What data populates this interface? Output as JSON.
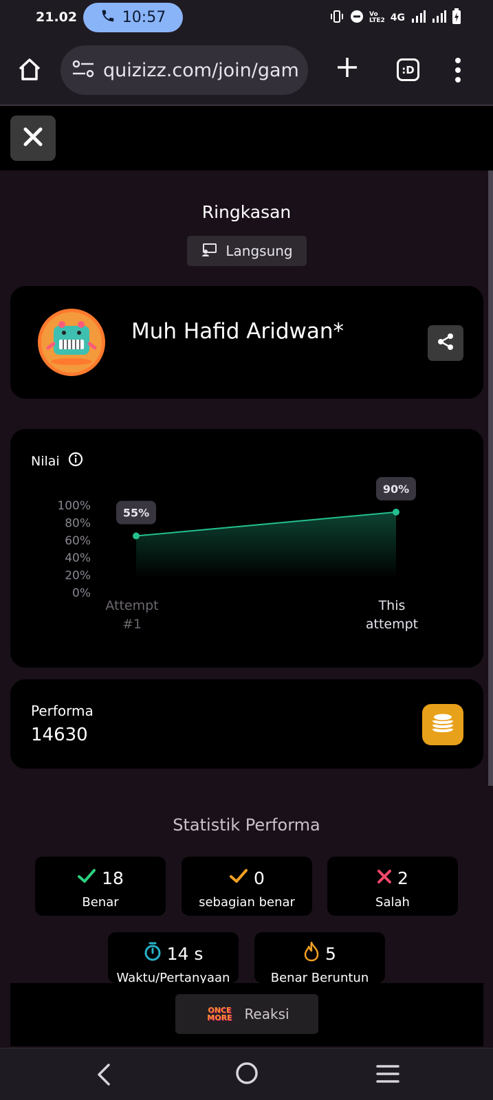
{
  "status_bar": {
    "time": "21.02",
    "call_time": "10:57",
    "network_label": "4G",
    "volte_label": "VoLTE2"
  },
  "browser": {
    "url": "quizizz.com/join/gam",
    "tabs_label": ":D"
  },
  "summary": {
    "title": "Ringkasan",
    "mode_label": "Langsung"
  },
  "player": {
    "name": "Muh Hafid Aridwan*"
  },
  "score": {
    "label": "Nilai"
  },
  "chart_data": {
    "type": "area",
    "categories": [
      "Attempt #1",
      "This attempt"
    ],
    "values": [
      55,
      90
    ],
    "value_labels": [
      "55%",
      "90%"
    ],
    "y_ticks": [
      "100%",
      "80%",
      "60%",
      "40%",
      "20%",
      "0%"
    ],
    "ylim": [
      0,
      100
    ],
    "line_color": "#24c08f"
  },
  "performance": {
    "label": "Performa",
    "value": "14630"
  },
  "stats": {
    "title": "Statistik Performa",
    "items": [
      {
        "value": "18",
        "label": "Benar",
        "icon": "check-icon",
        "color": "#2bd17e"
      },
      {
        "value": "0",
        "label": "sebagian benar",
        "icon": "check-icon",
        "color": "#f2a024"
      },
      {
        "value": "2",
        "label": "Salah",
        "icon": "cross-icon",
        "color": "#f2486b"
      },
      {
        "value": "14 s",
        "label": "Waktu/Pertanyaan",
        "icon": "stopwatch-icon",
        "color": "#26b3c9"
      },
      {
        "value": "5",
        "label": "Benar Beruntun",
        "icon": "flame-icon",
        "color": "#f2a024"
      }
    ]
  },
  "reactions": {
    "logo_text": "ONCE MORE",
    "label": "Reaksi"
  }
}
